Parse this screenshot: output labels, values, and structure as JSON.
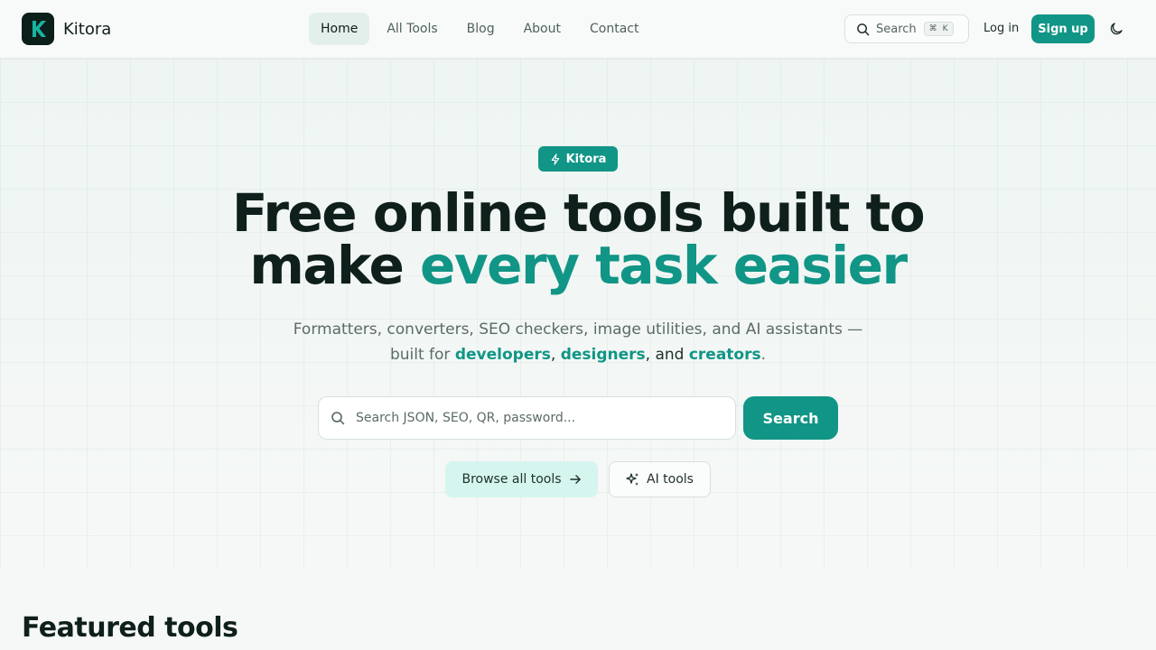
{
  "brand": {
    "name": "Kitora",
    "logo_letter": "K",
    "accent_color": "#119586"
  },
  "nav": {
    "items": [
      {
        "label": "Home",
        "active": true
      },
      {
        "label": "All Tools",
        "active": false
      },
      {
        "label": "Blog",
        "active": false
      },
      {
        "label": "About",
        "active": false
      },
      {
        "label": "Contact",
        "active": false
      }
    ]
  },
  "header": {
    "search_label": "Search",
    "search_shortcut_mod": "⌘",
    "search_shortcut_key": "K",
    "login_label": "Log in",
    "signup_label": "Sign up",
    "theme_icon": "moon-icon"
  },
  "hero": {
    "badge_label": "Kitora",
    "badge_icon": "lightning-icon",
    "headline_part1": "Free online tools built to",
    "headline_part2": "make ",
    "headline_accent": "every task easier",
    "subhead_line1": "Formatters, converters, SEO checkers, image utilities, and AI assistants —",
    "subhead_prefix": "built for ",
    "subhead_h1": "developers",
    "subhead_sep1": ", ",
    "subhead_h2": "designers",
    "subhead_sep2": ", and ",
    "subhead_h3": "creators",
    "subhead_end": ".",
    "search_placeholder": "Search JSON, SEO, QR, password...",
    "search_button": "Search",
    "browse_label": "Browse all tools",
    "ai_label": "AI tools"
  },
  "featured": {
    "title": "Featured tools"
  }
}
